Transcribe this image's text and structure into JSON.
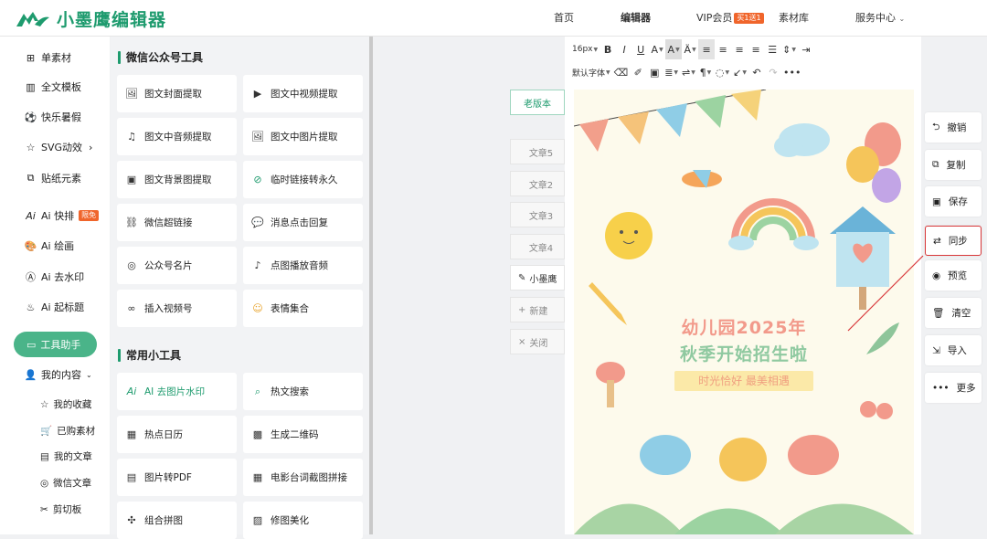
{
  "app": {
    "name": "小墨鹰编辑器"
  },
  "nav": {
    "home": "首页",
    "editor": "编辑器",
    "vip": "VIP会员",
    "vip_badge": "买1送1",
    "library": "素材库",
    "service": "服务中心"
  },
  "sidebar": {
    "items": [
      {
        "label": "单素材",
        "icon": "grid-icon"
      },
      {
        "label": "全文模板",
        "icon": "template-icon"
      },
      {
        "label": "快乐暑假",
        "icon": "ball-icon"
      },
      {
        "label": "SVG动效",
        "icon": "star-icon"
      },
      {
        "label": "贴纸元素",
        "icon": "sticker-icon"
      },
      {
        "label": "Ai 快排",
        "badge": "限免",
        "icon": "ai-icon"
      },
      {
        "label": "Ai 绘画",
        "icon": "palette-icon"
      },
      {
        "label": "Ai 去水印",
        "icon": "ai-watermark-icon"
      },
      {
        "label": "Ai 起标题",
        "icon": "flame-icon"
      }
    ],
    "tool_helper": "工具助手",
    "my_content": "我的内容",
    "sub_items": [
      {
        "label": "我的收藏",
        "icon": "star-outline-icon"
      },
      {
        "label": "已购素材",
        "icon": "cart-icon"
      },
      {
        "label": "我的文章",
        "icon": "doc-icon"
      },
      {
        "label": "微信文章",
        "icon": "wechat-icon"
      },
      {
        "label": "剪切板",
        "icon": "scissors-icon"
      }
    ]
  },
  "panel": {
    "section1": "微信公众号工具",
    "section2": "常用小工具",
    "tools1": [
      "图文封面提取",
      "图文中视频提取",
      "图文中音频提取",
      "图文中图片提取",
      "图文背景图提取",
      "临时链接转永久",
      "微信超链接",
      "消息点击回复",
      "公众号名片",
      "点图播放音频",
      "插入视频号",
      "表情集合"
    ],
    "tools2": [
      "AI 去图片水印",
      "热文搜索",
      "热点日历",
      "生成二维码",
      "图片转PDF",
      "电影台词截图拼接",
      "组合拼图",
      "修图美化"
    ]
  },
  "docs": {
    "old_version": "老版本",
    "articles": [
      "文章5",
      "文章2",
      "文章3",
      "文章4"
    ],
    "current": "小墨鹰",
    "new": "新建",
    "close": "关闭"
  },
  "toolbar": {
    "font_size": "16px",
    "font_family": "默认字体"
  },
  "poster": {
    "line1": "幼儿园2025年",
    "line2": "秋季开始招生啦",
    "slogan": "时光恰好 最美相遇"
  },
  "actions": [
    "撤销",
    "复制",
    "保存",
    "同步",
    "预览",
    "清空",
    "导入",
    "更多"
  ],
  "colors": {
    "brand": "#1e9b6e",
    "highlight": "#d9383a",
    "badge": "#f0652b"
  }
}
